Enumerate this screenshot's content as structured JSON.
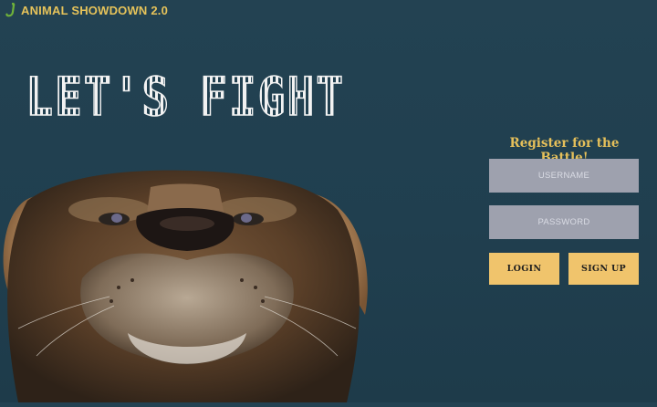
{
  "header": {
    "brand_name": "ANIMAL SHOWDOWN 2.0",
    "brand_icon": "serpent-logo-icon",
    "brand_color": "#e6c35a"
  },
  "hero": {
    "title": "LET'S FIGHT",
    "image": "lion-face-image"
  },
  "register": {
    "title": "Register for the Battle!",
    "username_placeholder": "USERNAME",
    "username_value": "",
    "password_placeholder": "PASSWORD",
    "password_value": "",
    "login_label": "LOGIN",
    "signup_label": "SIGN UP"
  },
  "colors": {
    "background": "#214050",
    "accent": "#f0c46c",
    "field": "#9ea1ae"
  }
}
